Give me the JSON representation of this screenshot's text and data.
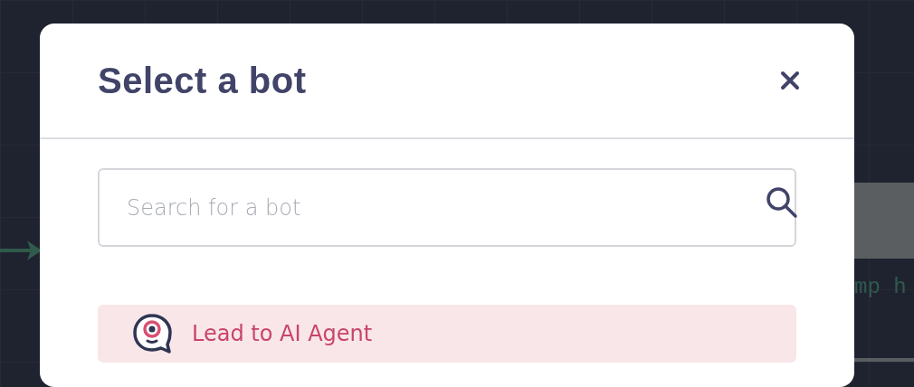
{
  "background": {
    "node_text": "mp h"
  },
  "dialog": {
    "title": "Select a bot",
    "search": {
      "placeholder": "Search for a bot"
    },
    "bots": [
      {
        "name": "Lead to AI Agent",
        "selected": true
      }
    ]
  }
}
